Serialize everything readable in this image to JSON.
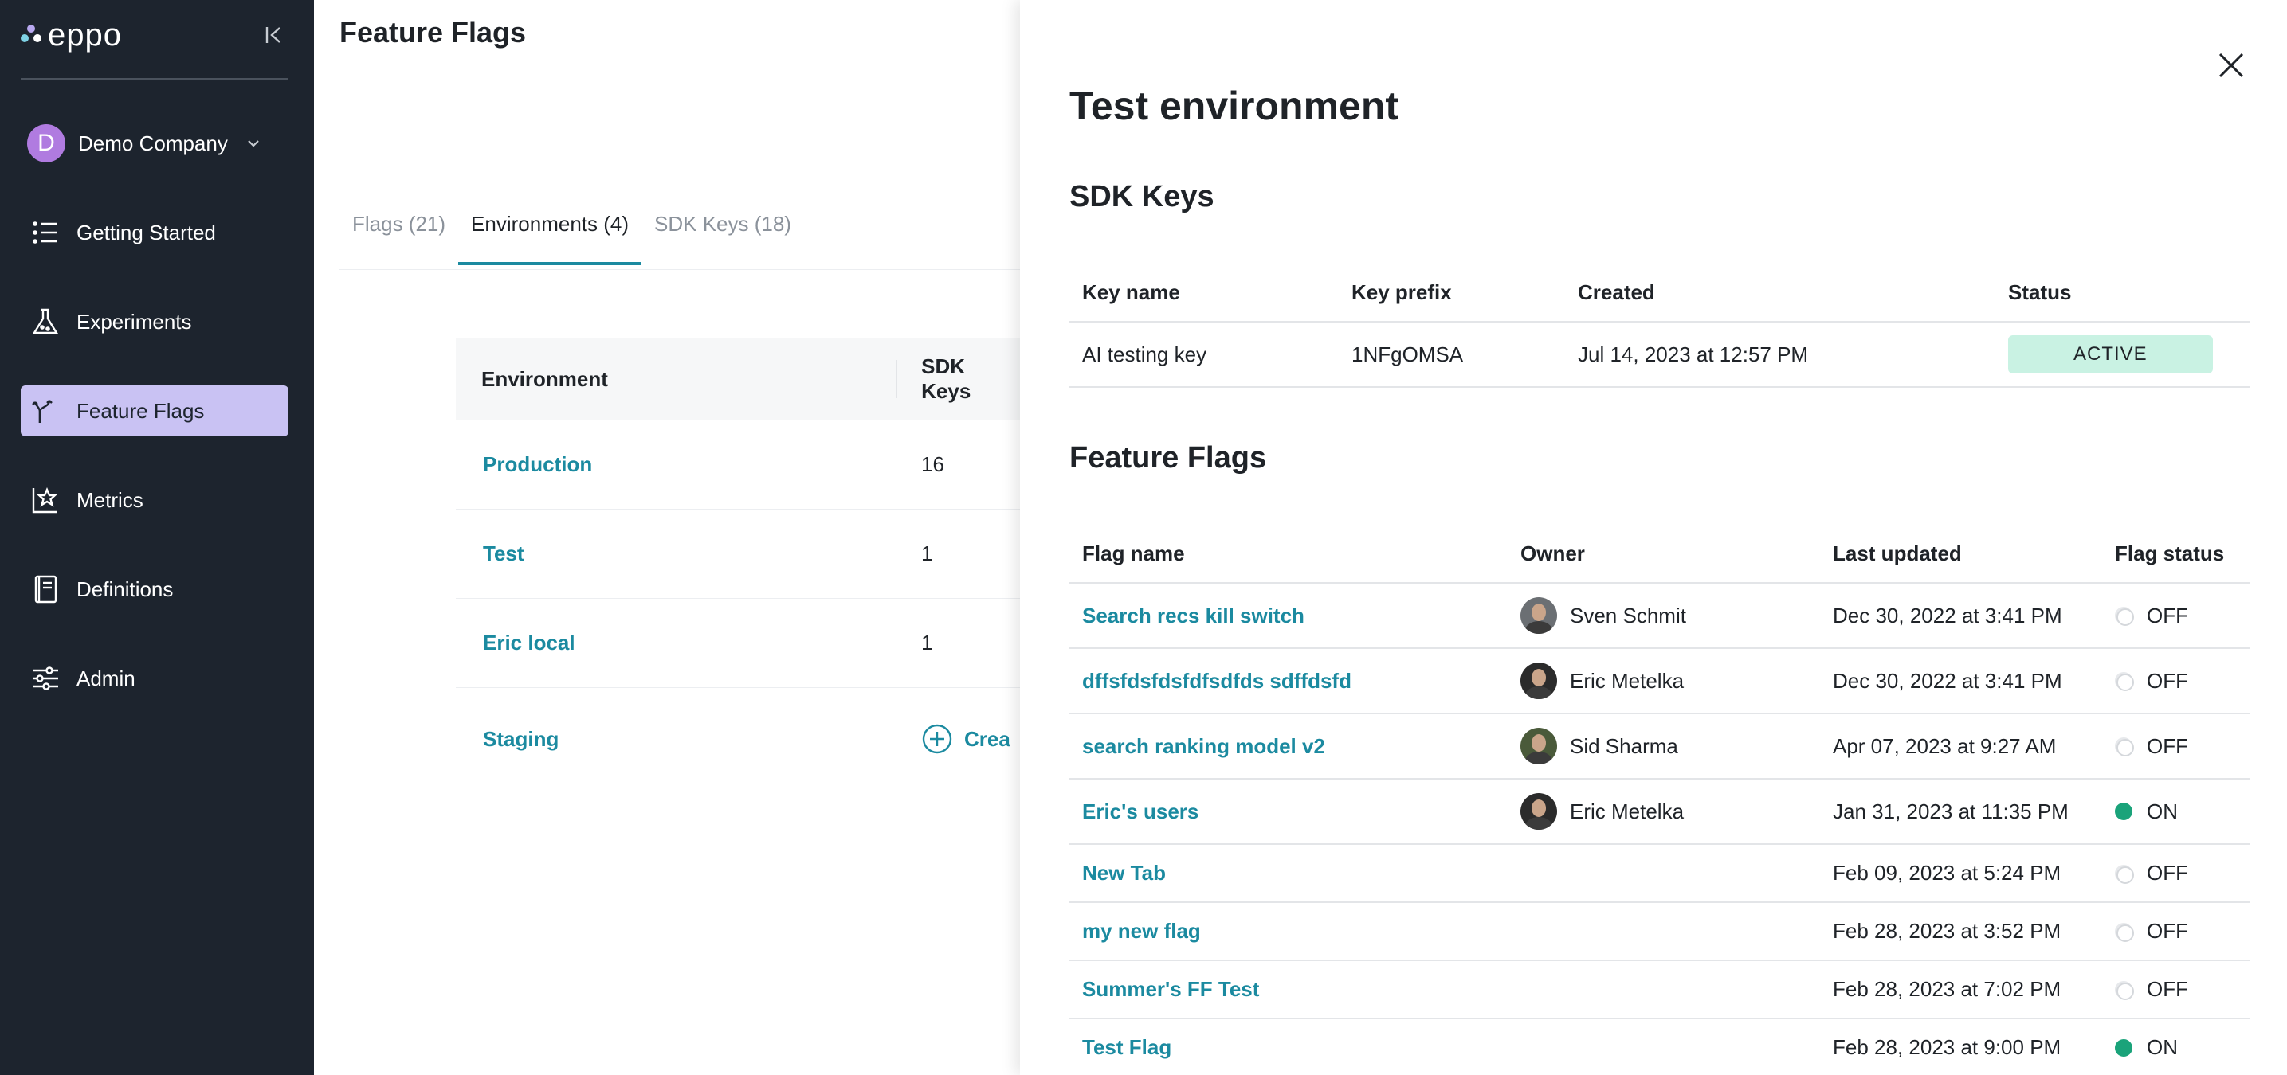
{
  "sidebar": {
    "logo_text": "eppo",
    "company": {
      "avatar_letter": "D",
      "name": "Demo Company"
    },
    "items": [
      {
        "label": "Getting Started",
        "icon": "list-icon"
      },
      {
        "label": "Experiments",
        "icon": "flask-icon"
      },
      {
        "label": "Feature Flags",
        "icon": "flag-branch-icon",
        "active": true
      },
      {
        "label": "Metrics",
        "icon": "chart-star-icon"
      },
      {
        "label": "Definitions",
        "icon": "book-icon"
      },
      {
        "label": "Admin",
        "icon": "sliders-icon"
      }
    ]
  },
  "main": {
    "title": "Feature Flags",
    "tabs": [
      "Flags (21)",
      "Environments (4)",
      "SDK Keys (18)"
    ],
    "active_tab": 1,
    "env_table": {
      "headers": [
        "Environment",
        "SDK Keys"
      ],
      "rows": [
        {
          "name": "Production",
          "keys": "16"
        },
        {
          "name": "Test",
          "keys": "1"
        },
        {
          "name": "Eric local",
          "keys": "1"
        },
        {
          "name": "Staging",
          "create_label": "Crea"
        }
      ]
    }
  },
  "panel": {
    "title": "Test environment",
    "sdk_section": {
      "title": "SDK Keys",
      "headers": [
        "Key name",
        "Key prefix",
        "Created",
        "Status"
      ],
      "rows": [
        {
          "name": "AI testing key",
          "prefix": "1NFgOMSA",
          "created": "Jul 14, 2023 at 12:57 PM",
          "status": "ACTIVE"
        }
      ]
    },
    "flags_section": {
      "title": "Feature Flags",
      "headers": [
        "Flag name",
        "Owner",
        "Last updated",
        "Flag status"
      ],
      "rows": [
        {
          "name": "Search recs kill switch",
          "owner": "Sven Schmit",
          "updated": "Dec 30, 2022 at 3:41 PM",
          "status": "OFF"
        },
        {
          "name": "dffsfdsfdsfdfsdfds sdffdsfd",
          "owner": "Eric Metelka",
          "updated": "Dec 30, 2022 at 3:41 PM",
          "status": "OFF"
        },
        {
          "name": "search ranking model v2",
          "owner": "Sid Sharma",
          "updated": "Apr 07, 2023 at 9:27 AM",
          "status": "OFF"
        },
        {
          "name": "Eric's users",
          "owner": "Eric Metelka",
          "updated": "Jan 31, 2023 at 11:35 PM",
          "status": "ON"
        },
        {
          "name": "New Tab",
          "owner": "",
          "updated": "Feb 09, 2023 at 5:24 PM",
          "status": "OFF"
        },
        {
          "name": "my new flag",
          "owner": "",
          "updated": "Feb 28, 2023 at 3:52 PM",
          "status": "OFF"
        },
        {
          "name": "Summer's FF Test",
          "owner": "",
          "updated": "Feb 28, 2023 at 7:02 PM",
          "status": "OFF"
        },
        {
          "name": "Test Flag",
          "owner": "",
          "updated": "Feb 28, 2023 at 9:00 PM",
          "status": "ON"
        }
      ]
    }
  },
  "colors": {
    "sidebar_bg": "#1d242e",
    "active_nav": "#c9c2f3",
    "accent": "#1b8aa0",
    "status_active": "#c9f2e3",
    "flag_on": "#1aa37a"
  }
}
